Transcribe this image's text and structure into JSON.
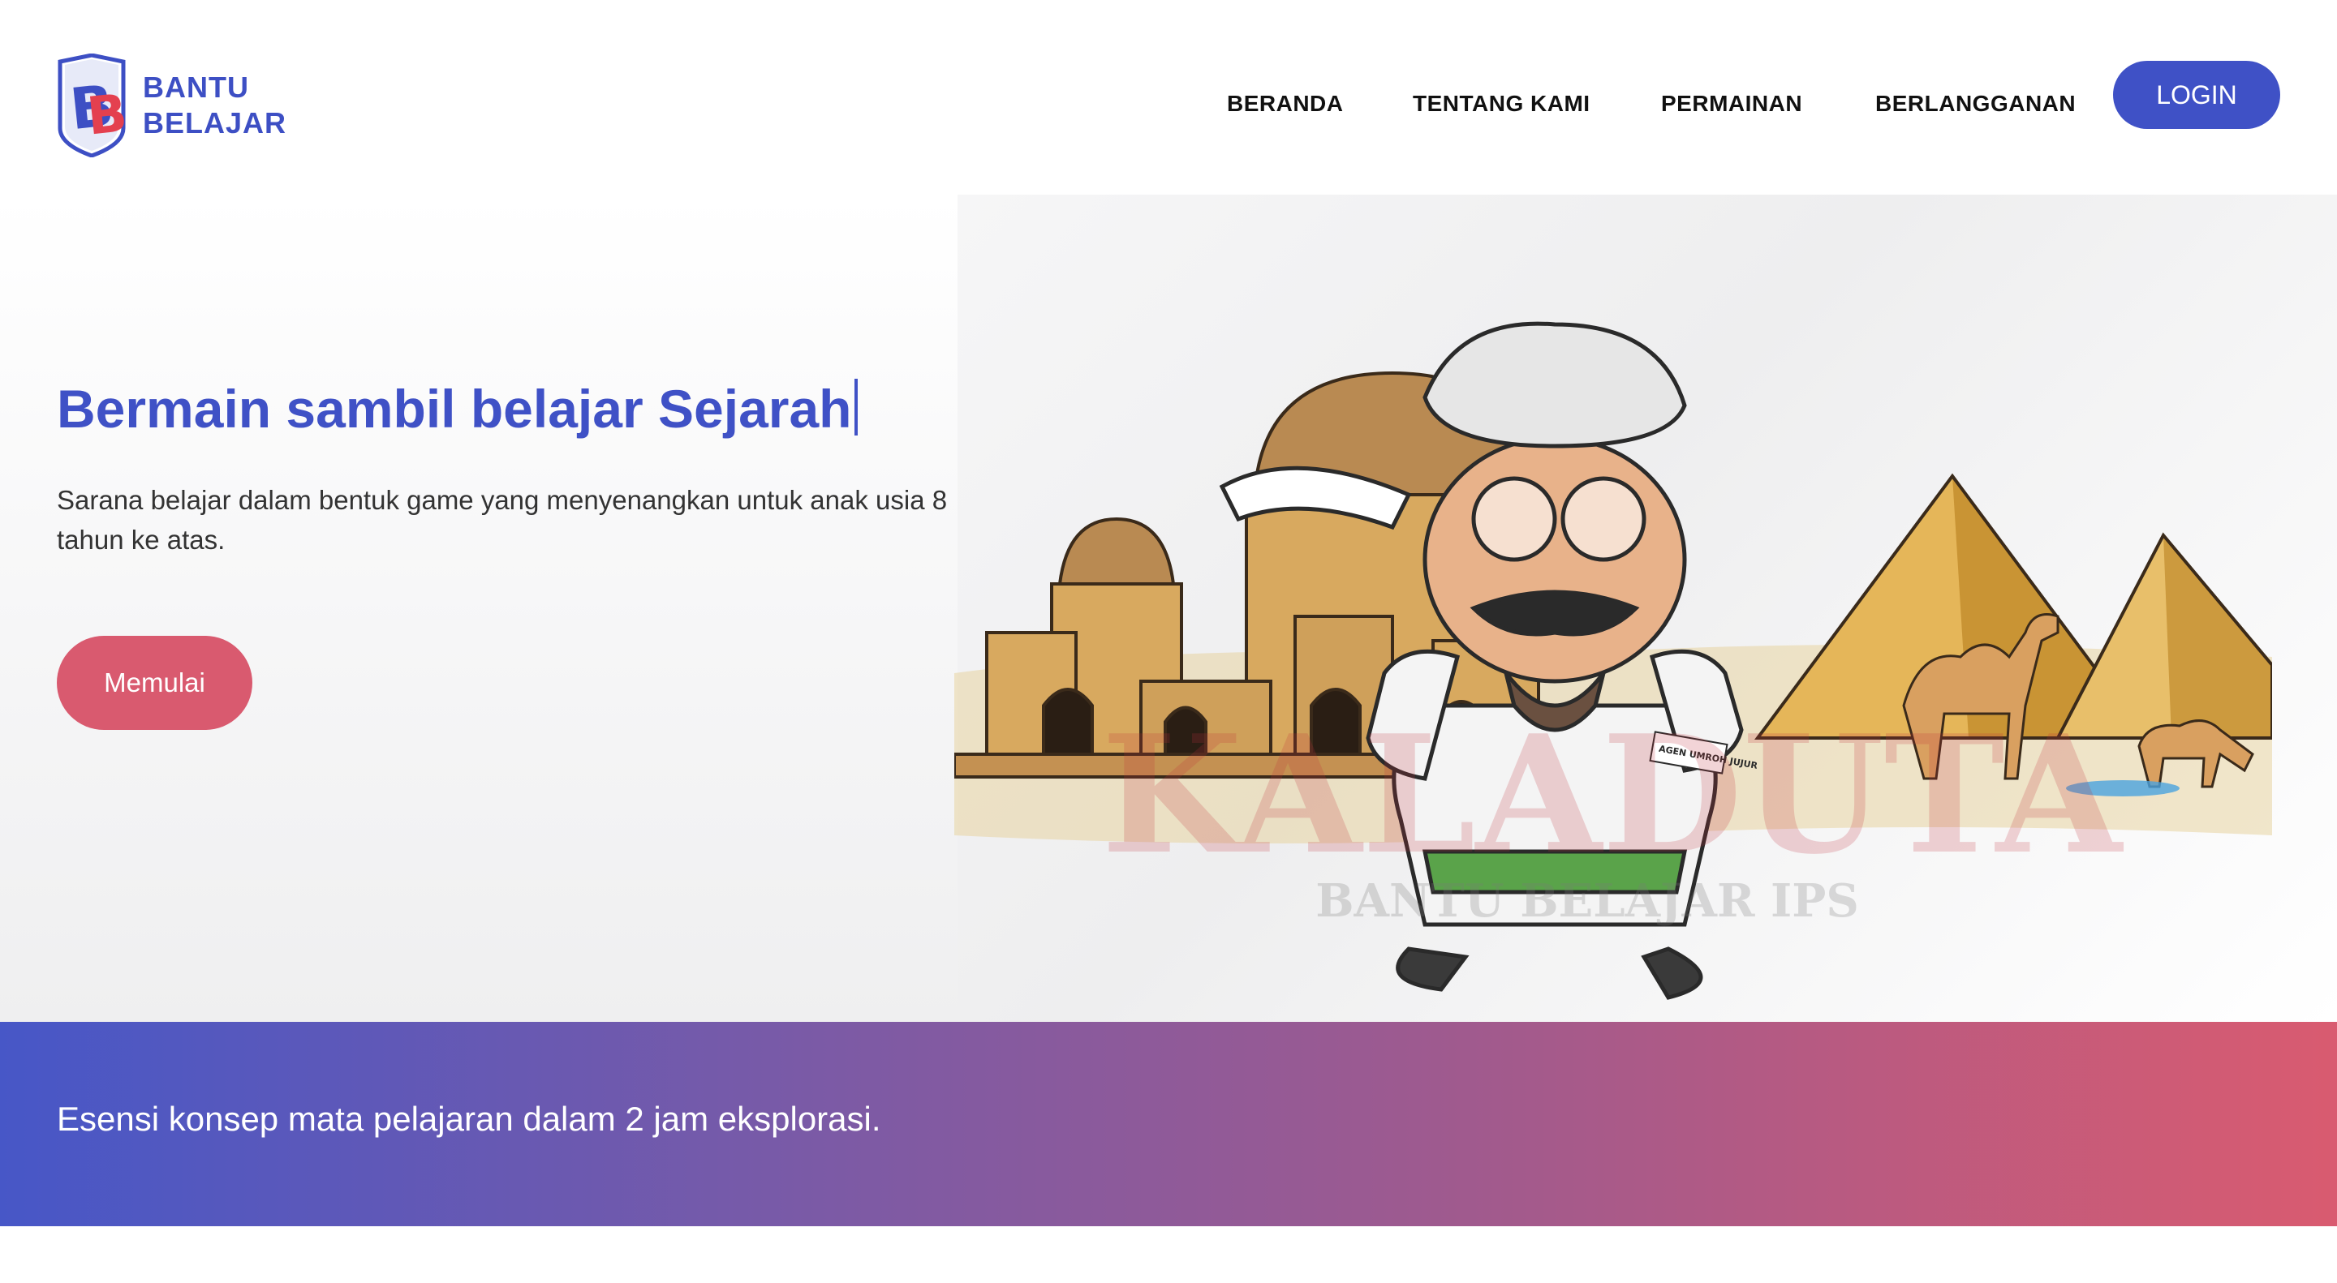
{
  "brand": {
    "line1": "BANTU",
    "line2": "BELAJAR",
    "icon": "bb-shield-logo",
    "color": "#3d4fc4",
    "accent": "#e4404f"
  },
  "nav": {
    "items": [
      {
        "label": "BERANDA"
      },
      {
        "label": "TENTANG KAMI"
      },
      {
        "label": "PERMAINAN"
      },
      {
        "label": "BERLANGGANAN"
      }
    ],
    "login_label": "LOGIN"
  },
  "hero": {
    "title_prefix": "Bermain sambil belajar ",
    "title_highlight": "Sejarah",
    "description": "Sarana belajar dalam bentuk game yang menyenangkan untuk anak usia 8 tahun ke atas.",
    "cta_label": "Memulai",
    "illustration": {
      "icon": "desert-mosque-pyramids-character",
      "watermark_main": "KALADUTA",
      "watermark_sub": "BANTU BELAJAR IPS",
      "badge_text": "AGEN UMROH JUJUR"
    }
  },
  "banner": {
    "text": "Esensi konsep mata pelajaran dalam 2 jam eksplorasi."
  },
  "colors": {
    "primary": "#3f51c6",
    "cta": "#d95a6f",
    "banner_start": "#4757c7",
    "banner_end": "#d95b70"
  }
}
